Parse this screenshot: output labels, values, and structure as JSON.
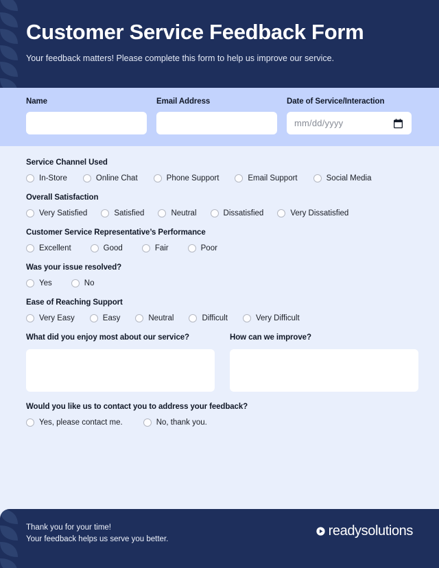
{
  "header": {
    "title": "Customer Service Feedback Form",
    "subtitle": "Your feedback matters! Please complete this form to help us improve our service.",
    "background_color": "#1e2f5c",
    "petal_color": "#2d4270"
  },
  "top_fields": {
    "background_color": "#c3d3fd",
    "name": {
      "label": "Name",
      "value": "",
      "placeholder": ""
    },
    "email": {
      "label": "Email Address",
      "value": "",
      "placeholder": ""
    },
    "date": {
      "label": "Date of Service/Interaction",
      "value": "",
      "placeholder": "mm/dd/yyyy",
      "icon": "calendar-icon"
    }
  },
  "body": {
    "background_color": "#e9effc",
    "groups": [
      {
        "id": "service-channel",
        "title": "Service Channel Used",
        "options": [
          "In-Store",
          "Online Chat",
          "Phone Support",
          "Email Support",
          "Social Media"
        ]
      },
      {
        "id": "overall-satisfaction",
        "title": "Overall Satisfaction",
        "options": [
          "Very Satisfied",
          "Satisfied",
          "Neutral",
          "Dissatisfied",
          "Very Dissatisfied"
        ]
      },
      {
        "id": "rep-performance",
        "title": "Customer Service Representative’s Performance",
        "options": [
          "Excellent",
          "Good",
          "Fair",
          "Poor"
        ]
      },
      {
        "id": "issue-resolved",
        "title": "Was your issue resolved?",
        "options": [
          "Yes",
          "No"
        ]
      },
      {
        "id": "ease-of-reaching",
        "title": "Ease of Reaching Support",
        "options": [
          "Very Easy",
          "Easy",
          "Neutral",
          "Difficult",
          "Very Difficult"
        ]
      }
    ],
    "textareas": [
      {
        "id": "enjoy-most",
        "label": "What did you enjoy most about our service?",
        "value": "",
        "placeholder": ""
      },
      {
        "id": "how-improve",
        "label": "How can we improve?",
        "value": "",
        "placeholder": ""
      }
    ],
    "contact_group": {
      "id": "contact-permission",
      "title": "Would you like us to contact you to address your feedback?",
      "options": [
        "Yes, please contact me.",
        "No, thank you."
      ]
    }
  },
  "footer": {
    "background_color": "#1e2f5c",
    "line1": "Thank you for your time!",
    "line2": "Your feedback helps us serve you better.",
    "logo_text": "readysolutions",
    "logo_icon": "play-circle-icon"
  }
}
